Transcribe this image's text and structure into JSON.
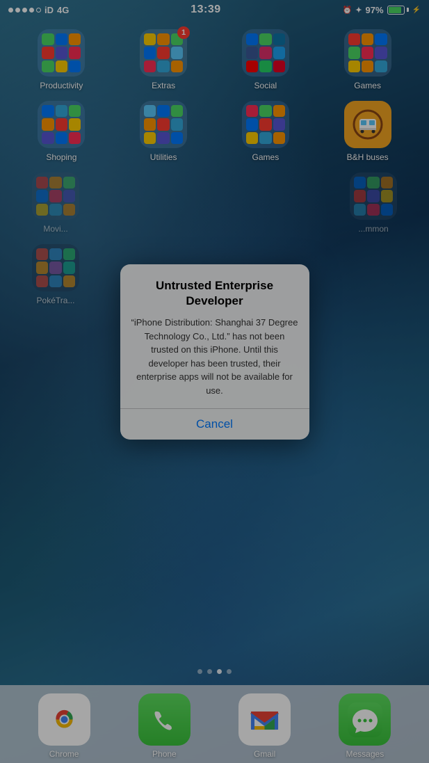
{
  "status_bar": {
    "signal": [
      "filled",
      "filled",
      "filled",
      "filled",
      "empty"
    ],
    "carrier": "iD",
    "network": "4G",
    "time": "13:39",
    "alarm_icon": "⏰",
    "bluetooth": "✦",
    "battery_pct": "97%"
  },
  "app_rows": [
    {
      "id": "row1",
      "apps": [
        {
          "id": "productivity",
          "label": "Productivity",
          "type": "folder"
        },
        {
          "id": "extras",
          "label": "Extras",
          "type": "folder",
          "badge": "1"
        },
        {
          "id": "social",
          "label": "Social",
          "type": "folder"
        },
        {
          "id": "games",
          "label": "Games",
          "type": "folder"
        }
      ]
    },
    {
      "id": "row2",
      "apps": [
        {
          "id": "shopping",
          "label": "Shoping",
          "type": "folder"
        },
        {
          "id": "utilities",
          "label": "Utilities",
          "type": "folder"
        },
        {
          "id": "games2",
          "label": "Games",
          "type": "folder"
        },
        {
          "id": "bh",
          "label": "B&H buses",
          "type": "special"
        }
      ]
    },
    {
      "id": "row3",
      "apps": [
        {
          "id": "movies",
          "label": "Movi...",
          "type": "folder",
          "partial_left": true
        },
        {
          "id": "row3_gap",
          "label": "",
          "type": "empty"
        },
        {
          "id": "common",
          "label": "...mmon",
          "type": "folder",
          "partial_right": true
        }
      ]
    },
    {
      "id": "row4",
      "apps": [
        {
          "id": "poke",
          "label": "PokéTra...",
          "type": "folder",
          "partial_left": true
        }
      ]
    }
  ],
  "page_dots": [
    {
      "active": false
    },
    {
      "active": false
    },
    {
      "active": true
    },
    {
      "active": false
    }
  ],
  "dock": {
    "items": [
      {
        "id": "chrome",
        "label": "Chrome"
      },
      {
        "id": "phone",
        "label": "Phone"
      },
      {
        "id": "gmail",
        "label": "Gmail"
      },
      {
        "id": "messages",
        "label": "Messages"
      }
    ]
  },
  "dialog": {
    "title": "Untrusted Enterprise Developer",
    "message": "“iPhone Distribution: Shanghai 37 Degree Technology Co., Ltd.” has not been trusted on this iPhone. Until this developer has been trusted, their enterprise apps will not be available for use.",
    "cancel_label": "Cancel"
  }
}
